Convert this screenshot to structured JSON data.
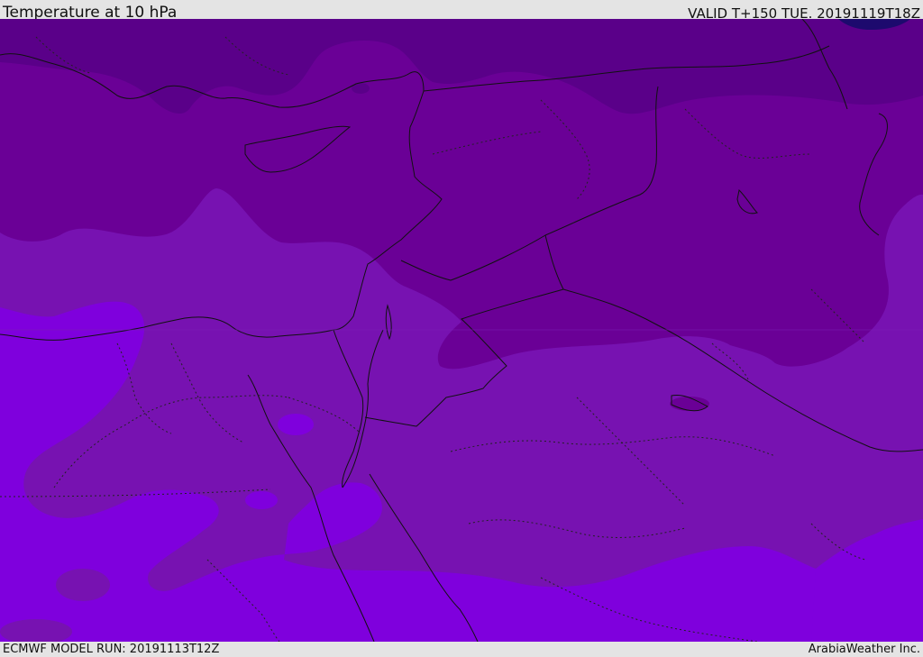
{
  "header": {
    "title": "Temperature at 10 hPa",
    "valid": "VALID T+150 TUE. 20191119T18Z"
  },
  "footer": {
    "model_run": "ECMWF MODEL RUN: 20191113T12Z",
    "credit": "ArabiaWeather Inc."
  },
  "colors": {
    "band_darkest": "#1d0a6e",
    "band_dark": "#5a0089",
    "band_mid": "#6a0096",
    "band_light": "#7712b1",
    "band_bright": "#7f00dd",
    "coastline": "#111111"
  },
  "map": {
    "region": "Eastern Mediterranean / Middle East",
    "variable": "temperature",
    "pressure_level": "10 hPa"
  }
}
